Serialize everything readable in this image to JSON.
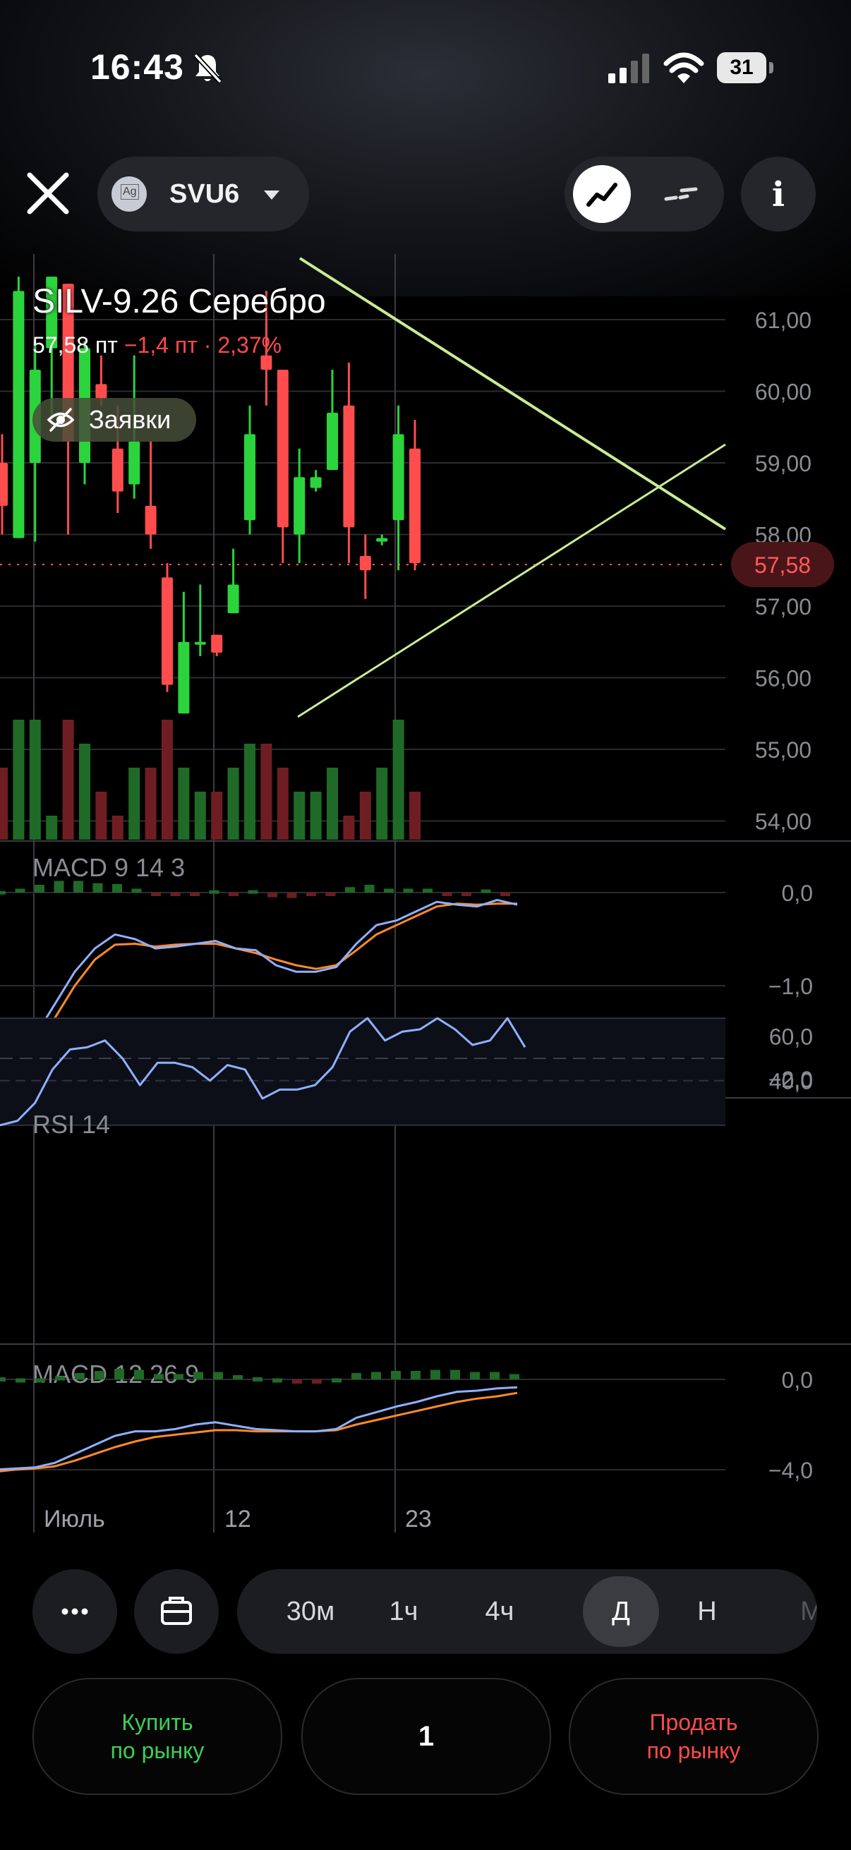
{
  "status_bar": {
    "time": "16:43",
    "battery": "31"
  },
  "header": {
    "ticker": "SVU6",
    "ticker_icon_label": "Ag",
    "info_label": "i"
  },
  "instrument": {
    "name": "SILV-9.26 Серебро",
    "price": "57,58 пт",
    "change": "−1,4 пт · 2,37%",
    "orders_label": "Заявки"
  },
  "colors": {
    "up": "#2bd43c",
    "down": "#ff4d4d",
    "trend": "#c9ec95",
    "macd_line": "#8fb0ff",
    "signal_line": "#ff8a2a",
    "price_tag_bg": "#4a1518"
  },
  "chart_data": {
    "type": "candlestick",
    "x_labels": [
      "Июль",
      "12",
      "23"
    ],
    "price_axis": {
      "ticks": [
        "61,00",
        "60,00",
        "59,00",
        "58,00",
        "57,00",
        "56,00",
        "55,00",
        "54,00"
      ],
      "last_price": "57,58"
    },
    "candles": [
      {
        "o": 59.0,
        "h": 59.4,
        "l": 58.0,
        "c": 58.4
      },
      {
        "o": 57.95,
        "h": 61.6,
        "l": 57.95,
        "c": 61.4
      },
      {
        "o": 59.0,
        "h": 60.7,
        "l": 57.9,
        "c": 60.3
      },
      {
        "o": 60.6,
        "h": 61.6,
        "l": 59.5,
        "c": 61.6
      },
      {
        "o": 61.5,
        "h": 61.5,
        "l": 58.0,
        "c": 59.3
      },
      {
        "o": 59.0,
        "h": 60.7,
        "l": 58.7,
        "c": 60.6
      },
      {
        "o": 60.1,
        "h": 60.5,
        "l": 59.8,
        "c": 59.9
      },
      {
        "o": 59.2,
        "h": 59.8,
        "l": 58.3,
        "c": 58.6
      },
      {
        "o": 58.7,
        "h": 60.5,
        "l": 58.5,
        "c": 59.3
      },
      {
        "o": 58.4,
        "h": 59.3,
        "l": 57.8,
        "c": 58.0
      },
      {
        "o": 57.4,
        "h": 57.6,
        "l": 55.8,
        "c": 55.9
      },
      {
        "o": 55.5,
        "h": 57.2,
        "l": 55.5,
        "c": 56.5
      },
      {
        "o": 56.5,
        "h": 57.3,
        "l": 56.3,
        "c": 56.5
      },
      {
        "o": 56.6,
        "h": 56.6,
        "l": 56.3,
        "c": 56.35
      },
      {
        "o": 56.9,
        "h": 57.8,
        "l": 56.9,
        "c": 57.3
      },
      {
        "o": 58.2,
        "h": 59.8,
        "l": 58.0,
        "c": 59.4
      },
      {
        "o": 60.5,
        "h": 61.4,
        "l": 59.8,
        "c": 60.3
      },
      {
        "o": 60.3,
        "h": 60.3,
        "l": 57.6,
        "c": 58.1
      },
      {
        "o": 58.0,
        "h": 59.2,
        "l": 57.6,
        "c": 58.8
      },
      {
        "o": 58.65,
        "h": 58.9,
        "l": 58.6,
        "c": 58.8
      },
      {
        "o": 58.9,
        "h": 60.3,
        "l": 58.9,
        "c": 59.7
      },
      {
        "o": 59.8,
        "h": 60.4,
        "l": 57.6,
        "c": 58.1
      },
      {
        "o": 57.7,
        "h": 58.0,
        "l": 57.1,
        "c": 57.5
      },
      {
        "o": 57.9,
        "h": 58.0,
        "l": 57.85,
        "c": 57.95
      },
      {
        "o": 58.2,
        "h": 59.8,
        "l": 57.5,
        "c": 59.4
      },
      {
        "o": 59.2,
        "h": 59.6,
        "l": 57.5,
        "c": 57.6
      }
    ],
    "volume": [
      3,
      5,
      5,
      1,
      5,
      4,
      2,
      1,
      3,
      3,
      5,
      3,
      2,
      2,
      3,
      4,
      4,
      3,
      2,
      2,
      3,
      1,
      2,
      3,
      5,
      2
    ],
    "macd_short": {
      "label": "MACD 9 14 3",
      "ticks": [
        "0,0",
        "−1,0",
        "−2,0"
      ],
      "macd": [
        -1.88,
        -1.75,
        -1.55,
        -1.2,
        -0.85,
        -0.6,
        -0.45,
        -0.5,
        -0.6,
        -0.58,
        -0.55,
        -0.52,
        -0.6,
        -0.62,
        -0.78,
        -0.85,
        -0.85,
        -0.8,
        -0.55,
        -0.35,
        -0.3,
        -0.2,
        -0.1,
        -0.13,
        -0.15,
        -0.08,
        -0.13
      ],
      "signal": [
        -1.9,
        -1.8,
        -1.65,
        -1.35,
        -1.0,
        -0.72,
        -0.56,
        -0.55,
        -0.58,
        -0.56,
        -0.55,
        -0.55,
        -0.6,
        -0.65,
        -0.72,
        -0.78,
        -0.82,
        -0.78,
        -0.62,
        -0.45,
        -0.35,
        -0.25,
        -0.15,
        -0.12,
        -0.13,
        -0.12,
        -0.12
      ]
    },
    "rsi": {
      "label": "RSI 14",
      "ticks": [
        "60,0",
        "40,0"
      ],
      "values": [
        20,
        22,
        30,
        45,
        54,
        55,
        58,
        50,
        38,
        48,
        48,
        46,
        40,
        47,
        45,
        32,
        36,
        36,
        38,
        46,
        62,
        68,
        58,
        62,
        63,
        68,
        63,
        56,
        58,
        68,
        55
      ]
    },
    "macd_long": {
      "label": "MACD 12 26 9",
      "ticks": [
        "0,0",
        "−4,0"
      ],
      "macd": [
        -4.0,
        -3.95,
        -3.9,
        -3.7,
        -3.3,
        -2.9,
        -2.5,
        -2.3,
        -2.3,
        -2.2,
        -2.0,
        -1.9,
        -2.05,
        -2.2,
        -2.25,
        -2.3,
        -2.3,
        -2.2,
        -1.7,
        -1.45,
        -1.2,
        -1.0,
        -0.75,
        -0.55,
        -0.5,
        -0.4,
        -0.35
      ],
      "signal": [
        -4.1,
        -4.0,
        -3.95,
        -3.85,
        -3.6,
        -3.3,
        -3.0,
        -2.75,
        -2.55,
        -2.45,
        -2.35,
        -2.25,
        -2.25,
        -2.3,
        -2.3,
        -2.3,
        -2.3,
        -2.25,
        -2.0,
        -1.8,
        -1.6,
        -1.4,
        -1.2,
        -1.0,
        -0.85,
        -0.75,
        -0.6
      ]
    }
  },
  "toolbar": {
    "more_label": "···",
    "timeframes": [
      "30м",
      "1ч",
      "4ч",
      "Д",
      "Н",
      "М"
    ],
    "active_timeframe": "Д"
  },
  "order_panel": {
    "buy_line1": "Купить",
    "buy_line2": "по рынку",
    "quantity": "1",
    "sell_line1": "Продать",
    "sell_line2": "по рынку"
  }
}
